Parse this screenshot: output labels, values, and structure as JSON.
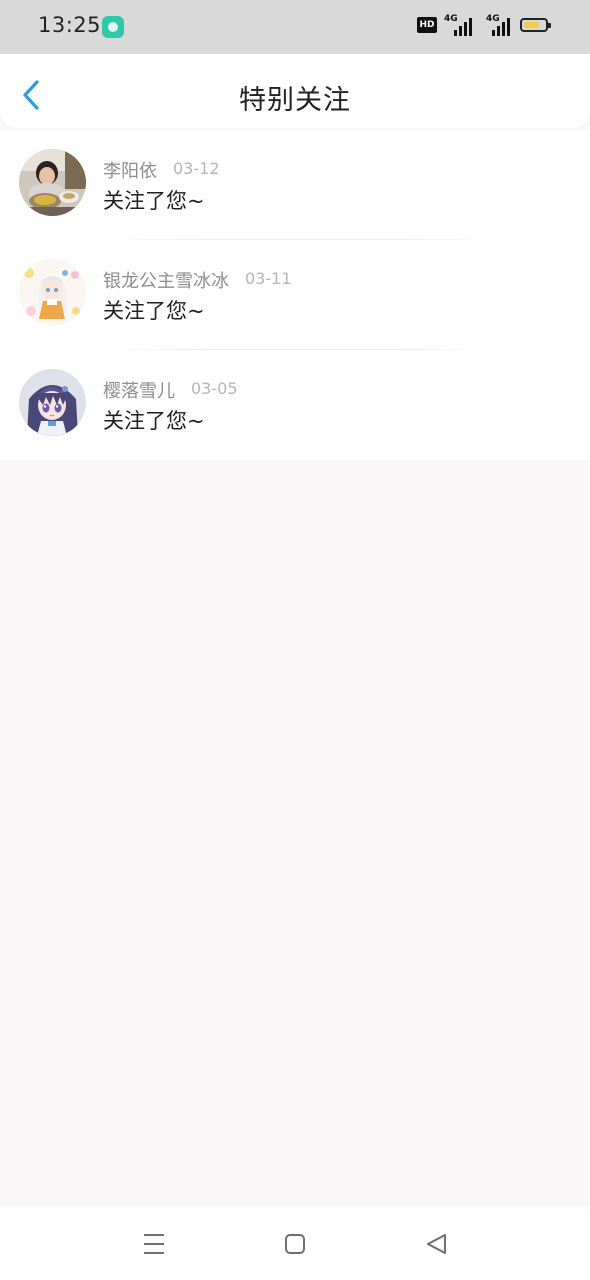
{
  "status_bar": {
    "time": "13:25",
    "hd_badge": "HD",
    "network_1": "4G",
    "network_2": "4G",
    "battery_level": 0.75,
    "notification_icon": "chat-bubble-icon"
  },
  "header": {
    "title": "特别关注",
    "back_icon": "chevron-left-icon",
    "accent": "#2d9cdb"
  },
  "list": {
    "items": [
      {
        "name": "李阳依",
        "date": "03-12",
        "message": "关注了您~",
        "avatar": "photo-avatar"
      },
      {
        "name": "银龙公主雪冰冰",
        "date": "03-11",
        "message": "关注了您~",
        "avatar": "anime-girl-avatar"
      },
      {
        "name": "樱落雪儿",
        "date": "03-05",
        "message": "关注了您~",
        "avatar": "anime-girl-avatar"
      }
    ]
  },
  "nav_bar": {
    "menu_icon": "menu-icon",
    "home_icon": "home-square-icon",
    "back_icon": "back-triangle-icon"
  }
}
